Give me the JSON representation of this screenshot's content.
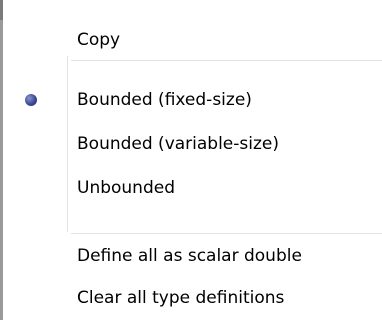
{
  "menu": {
    "copy_label": "Copy",
    "options": [
      {
        "label": "Bounded (fixed-size)",
        "checked": true
      },
      {
        "label": "Bounded (variable-size)",
        "checked": false
      },
      {
        "label": "Unbounded",
        "checked": false
      }
    ],
    "define_scalar_label": "Define all as scalar double",
    "clear_types_label": "Clear all type definitions"
  },
  "colors": {
    "separator": "#e2e3e3",
    "radio_dot": "#3b4a94",
    "background": "#ffffff",
    "text": "#000000"
  }
}
